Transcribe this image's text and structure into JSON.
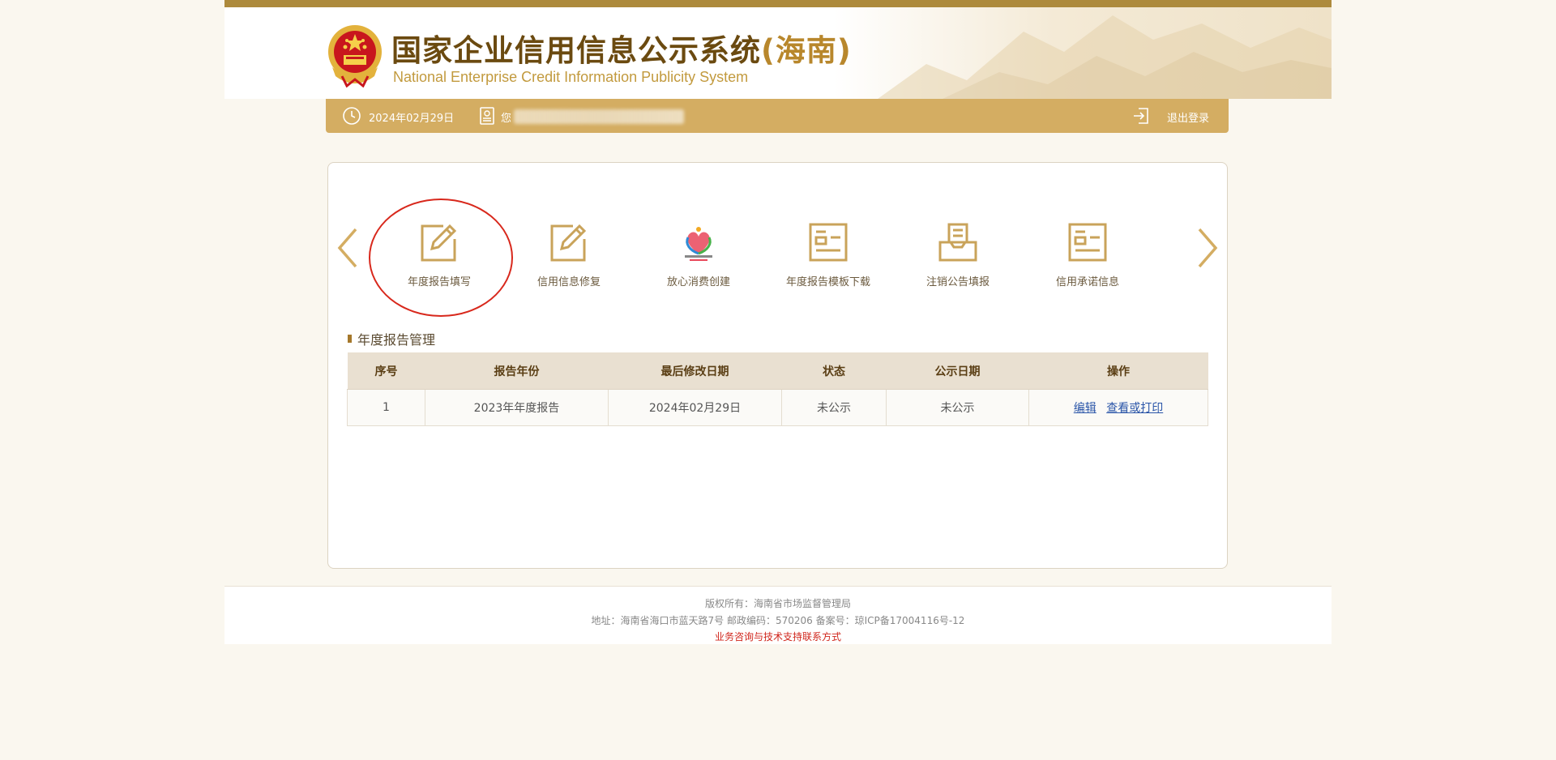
{
  "header": {
    "title_main": "国家企业信用信息公示系统",
    "title_region": "(海南)",
    "subtitle": "National Enterprise Credit Information Publicity System"
  },
  "user_bar": {
    "date": "2024年02月29日",
    "greeting": "您",
    "logout_label": "退出登录",
    "icons": [
      "clock-icon",
      "user-badge-icon",
      "logout-icon"
    ]
  },
  "tiles": [
    {
      "label": "年度报告填写",
      "icon": "edit-icon",
      "highlighted": true
    },
    {
      "label": "信用信息修复",
      "icon": "edit-icon"
    },
    {
      "label": "放心消费创建",
      "icon": "consumer-logo-icon"
    },
    {
      "label": "年度报告模板下载",
      "icon": "document-icon"
    },
    {
      "label": "注销公告填报",
      "icon": "inbox-icon"
    },
    {
      "label": "信用承诺信息",
      "icon": "document-icon"
    }
  ],
  "section": {
    "title": "年度报告管理"
  },
  "table": {
    "headers": [
      "序号",
      "报告年份",
      "最后修改日期",
      "状态",
      "公示日期",
      "操作"
    ],
    "rows": [
      {
        "index": "1",
        "year": "2023年年度报告",
        "modified": "2024年02月29日",
        "status": "未公示",
        "publish_date": "未公示",
        "action_edit": "编辑",
        "action_view": "查看或打印"
      }
    ]
  },
  "footer": {
    "copyright": "版权所有：海南省市场监督管理局",
    "address": "地址：海南省海口市蓝天路7号 邮政编码：570206 备案号：琼ICP备17004116号-12",
    "support_link": "业务咨询与技术支持联系方式"
  },
  "colors": {
    "gold": "#d4ad62",
    "dark_gold": "#ad8a3c",
    "title_brown": "#6b4a10",
    "highlight_red": "#d8281c",
    "link_blue": "#2a55a8"
  }
}
